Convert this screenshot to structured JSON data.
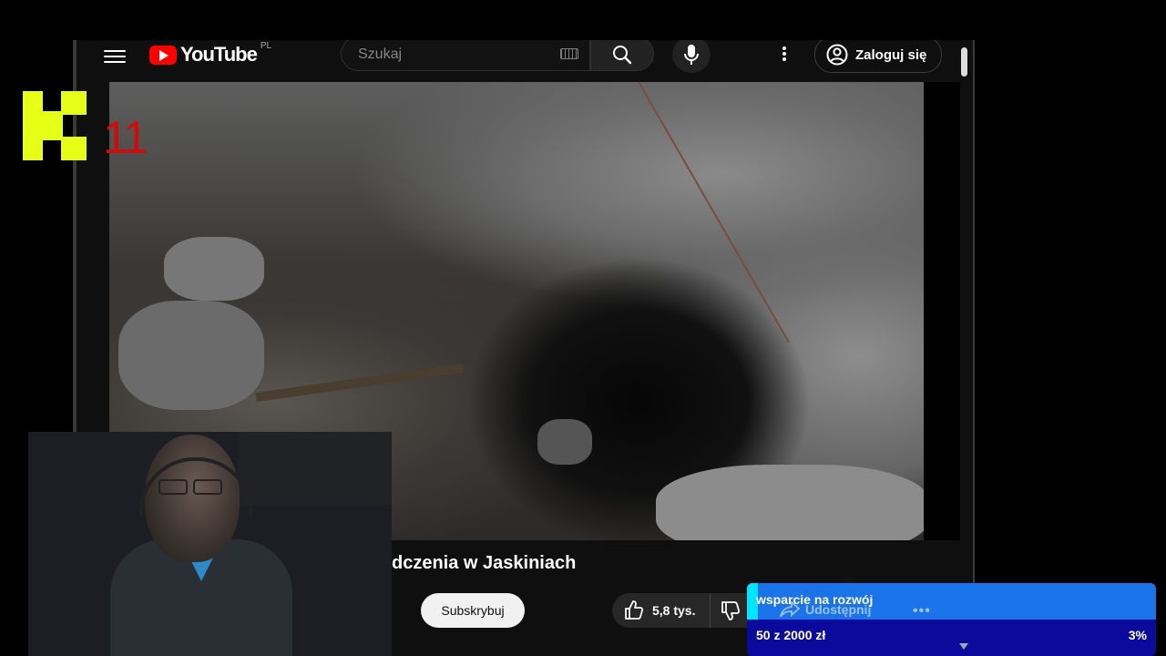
{
  "header": {
    "logo_text": "YouTube",
    "logo_country": "PL",
    "search_placeholder": "Szukaj",
    "login_label": "Zaloguj się"
  },
  "video": {
    "title": "dczenia w Jaskiniach",
    "subscribe_label": "Subskrybuj",
    "likes": "5,8 tys."
  },
  "overlay_logo": {
    "number": "11"
  },
  "donation": {
    "label": "wsparcie na rozwój",
    "ghost_share": "Udostępnij",
    "ghost_more": "•••",
    "amount": "50 z 2000 zł",
    "percent": "3%"
  },
  "colors": {
    "youtube_red": "#ff0000",
    "k11_yellow": "#e6ff16",
    "k11_red": "#d10a0a",
    "donation_blue": "#1a73e8",
    "donation_navy": "#0a0a9c"
  }
}
